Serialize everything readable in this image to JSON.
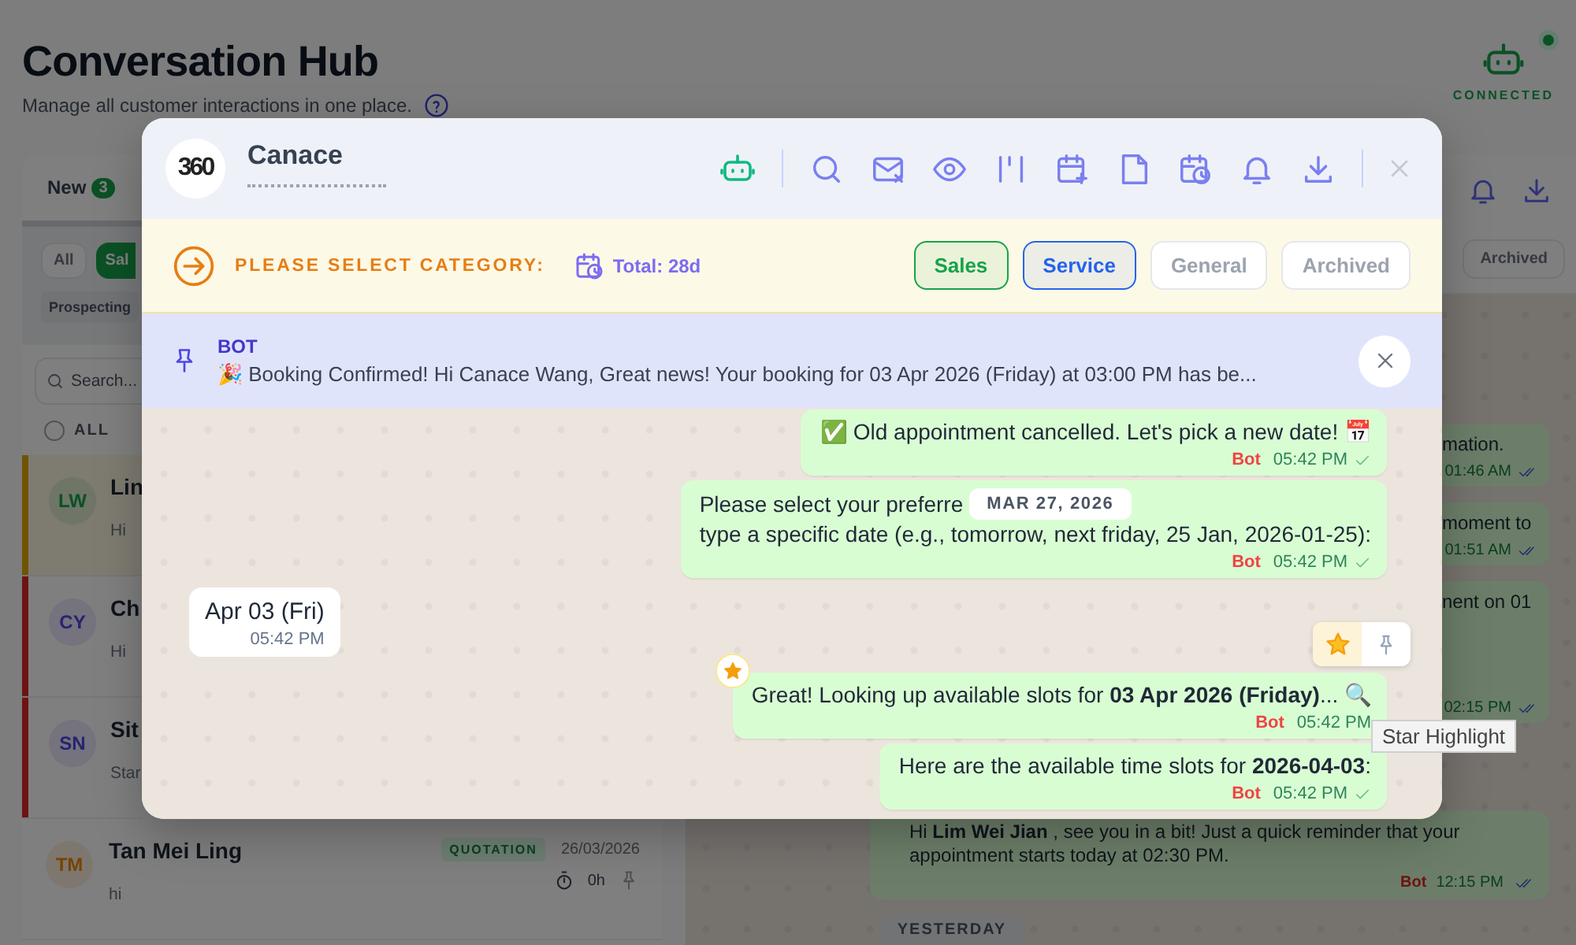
{
  "page": {
    "title": "Conversation Hub",
    "subtitle": "Manage all customer interactions in one place.",
    "status": "CONNECTED"
  },
  "list_panel": {
    "tabs": [
      {
        "label": "New",
        "count": "3",
        "selected": true
      }
    ],
    "filters": [
      {
        "label": "All",
        "selected": false
      },
      {
        "label": "Sal",
        "selected": true
      }
    ],
    "stage_filter": "Prospecting",
    "search": {
      "placeholder": "Search..."
    },
    "select_all": {
      "label": "ALL",
      "checked": false
    },
    "conversations": [
      {
        "initials": "LW",
        "name": "Lin",
        "preview": "Hi",
        "color": "#705400",
        "selected": true
      },
      {
        "initials": "CY",
        "name": "Ch",
        "preview": "Hi",
        "color": "#6e1313",
        "selected": false
      },
      {
        "initials": "SN",
        "name": "Sit",
        "preview": "Star",
        "color": "#6e1313",
        "selected": false
      },
      {
        "initials": "TM",
        "name": "Tan Mei Ling",
        "tag": "QUOTATION",
        "date": "26/03/2026",
        "duration": "0h",
        "preview": "hi",
        "selected": false
      }
    ]
  },
  "chat_panel": {
    "filter_chip": "Archived",
    "fragments": [
      {
        "text": "mation.",
        "time": "01:46 AM"
      },
      {
        "text": "moment to",
        "time": "01:51 AM"
      },
      {
        "text": "nent on 01",
        "time": "02:15 PM"
      }
    ],
    "reminder": {
      "text": "Hi **Lim Wei Jian** , see you in a bit! Just a quick reminder that your appointment starts today at 02:30 PM.",
      "sender": "Bot",
      "time": "12:15 PM"
    },
    "day_divider": "YESTERDAY"
  },
  "modal": {
    "logo": "360",
    "contact": "Canace",
    "category": {
      "prompt": "PLEASE SELECT CATEGORY:",
      "total": "Total: 28d",
      "options": [
        {
          "label": "Sales",
          "color": "#16a34a",
          "selected": true
        },
        {
          "label": "Service",
          "color": "#2563eb",
          "selected": true
        },
        {
          "label": "General",
          "color": "#9ca3af",
          "selected": false
        },
        {
          "label": "Archived",
          "color": "#9ca3af",
          "selected": false
        }
      ]
    },
    "pinned": {
      "sender": "BOT",
      "text": "🎉 Booking Confirmed! Hi Canace Wang, Great news! Your booking for 03 Apr 2026 (Friday) at 03:00 PM has be..."
    },
    "messages": [
      {
        "kind": "outgoing",
        "text": "✅ Old appointment cancelled. Let's pick a new date! 📅",
        "sender": "Bot",
        "time": "05:42 PM",
        "starred": false,
        "hovered": false
      },
      {
        "kind": "outgoing",
        "text": "Please select your preferre",
        "date_label": "MAR 27, 2026",
        "text_after": "type a specific date (e.g., tomorrow, next friday, 25 Jan, 2026-01-25):",
        "sender": "Bot",
        "time": "05:42 PM",
        "starred": false,
        "hovered": false
      },
      {
        "kind": "incoming",
        "text": "Apr 03 (Fri)",
        "time": "05:42 PM",
        "starred": false,
        "hovered": false
      },
      {
        "kind": "outgoing",
        "text": "Great! Looking up available slots for **03 Apr 2026 (Friday)**... 🔍",
        "sender": "Bot",
        "time": "05:42 PM",
        "starred": true,
        "hovered": true,
        "tooltip": "Star Highlight"
      },
      {
        "kind": "outgoing",
        "text": "Here are the available time slots for **2026-04-03**:",
        "sender": "Bot",
        "time": "05:42 PM",
        "starred": false,
        "hovered": false
      }
    ]
  }
}
